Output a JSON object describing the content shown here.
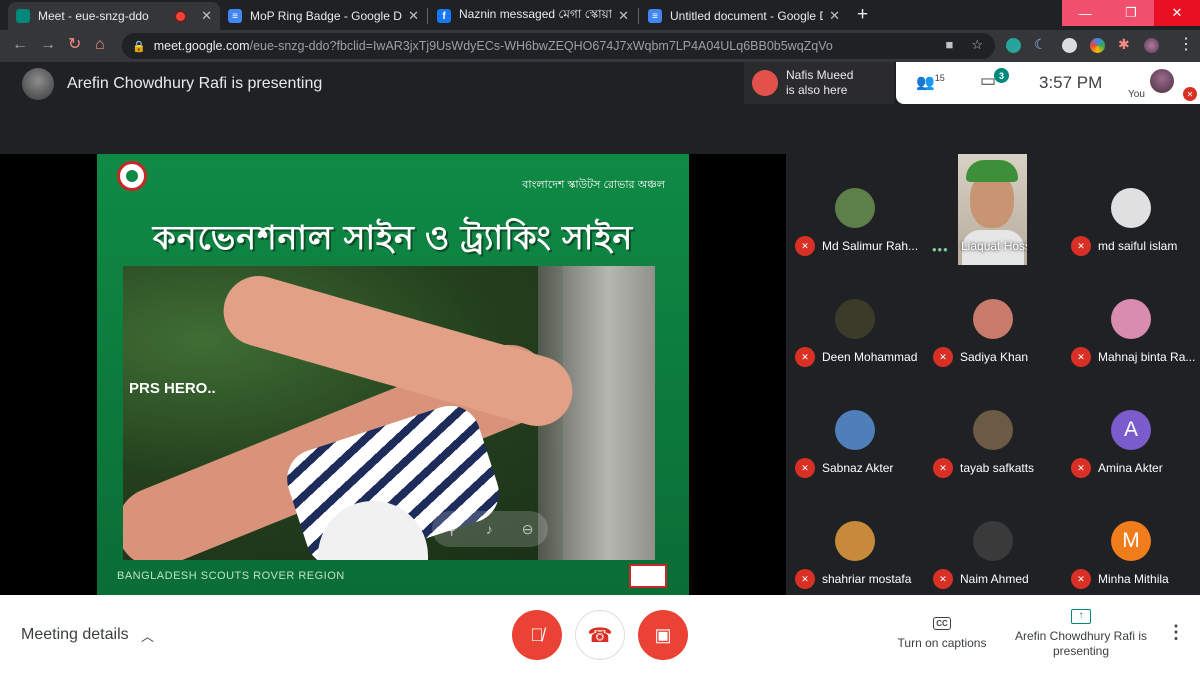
{
  "browser": {
    "tabs": [
      {
        "title": "Meet - eue-snzg-ddo",
        "favicon": "meet-icon",
        "active": true,
        "recording": true
      },
      {
        "title": "MoP Ring Badge - Google Docs",
        "favicon": "docs-icon",
        "active": false
      },
      {
        "title": "Naznin messaged মেগা স্কোয়াড",
        "favicon": "facebook-icon",
        "active": false
      },
      {
        "title": "Untitled document - Google Docs",
        "favicon": "docs-icon",
        "active": false
      }
    ],
    "address": {
      "host": "meet.google.com",
      "path": "/eue-snzg-ddo?fbclid=IwAR3jxTj9UsWdyECs-WH6bwZEQHO674J7xWqbm7LP4A04ULq6BB0b5wqZqVo"
    }
  },
  "meet": {
    "presenting_label": "Arefin Chowdhury Rafi is presenting",
    "also_here": {
      "name": "Nafis Mueed",
      "text": "is also here"
    },
    "people_count": "15",
    "chat_badge": "3",
    "time": "3:57 PM",
    "you_label": "You"
  },
  "slide": {
    "org": "বাংলাদেশ স্কাউটস রোভার অঞ্চল",
    "heading": "কনভেনশনাল সাইন ও ট্র্যাকিং সাইন",
    "overlay_text": "PRS HERO..",
    "footer": "BANGLADESH SCOUTS ROVER REGION"
  },
  "participants": [
    {
      "name": "Md Salimur Rah...",
      "avatar": "photo",
      "color": "#5d7f4a",
      "muted": true
    },
    {
      "name": "Liaquat Hossain",
      "avatar": "video",
      "muted": false
    },
    {
      "name": "md saiful islam",
      "avatar": "photo",
      "color": "#e0e0e0",
      "muted": true
    },
    {
      "name": "Deen Mohammad",
      "avatar": "photo",
      "color": "#3b3b2a",
      "muted": true
    },
    {
      "name": "Sadiya Khan",
      "avatar": "photo",
      "color": "#c97a6a",
      "muted": true
    },
    {
      "name": "Mahnaj binta Ra...",
      "avatar": "photo",
      "color": "#d98bb0",
      "muted": true
    },
    {
      "name": "Sabnaz Akter",
      "avatar": "photo",
      "color": "#4f7fb8",
      "muted": true
    },
    {
      "name": "tayab safkatts",
      "avatar": "photo",
      "color": "#6b5a44",
      "muted": true
    },
    {
      "name": "Amina Akter",
      "avatar": "letter",
      "letter": "A",
      "color": "#7b5ccc",
      "muted": true
    },
    {
      "name": "shahriar mostafa",
      "avatar": "photo",
      "color": "#c78a3a",
      "muted": true
    },
    {
      "name": "Naim Ahmed",
      "avatar": "photo",
      "color": "#3a3a3a",
      "muted": true
    },
    {
      "name": "Minha Mithila",
      "avatar": "letter",
      "letter": "M",
      "color": "#f07c1c",
      "muted": true
    }
  ],
  "bottom": {
    "meeting_details": "Meeting details",
    "captions": "Turn on captions",
    "presenting": "Arefin Chowdhury Rafi is presenting"
  }
}
